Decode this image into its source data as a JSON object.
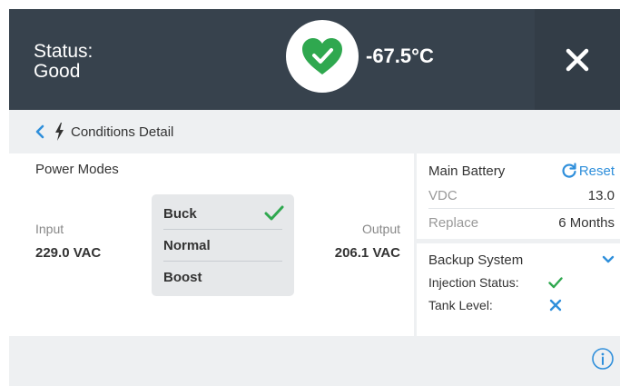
{
  "header": {
    "status_label": "Status:",
    "status_value": "Good",
    "temperature": "-67.5°C",
    "colors": {
      "background": "#37424d",
      "heart": "#2fa84f"
    }
  },
  "subbar": {
    "title": "Conditions Detail"
  },
  "power_modes": {
    "title": "Power Modes",
    "input_label": "Input",
    "input_value": "229.0 VAC",
    "output_label": "Output",
    "output_value": "206.1 VAC",
    "modes": [
      {
        "label": "Buck",
        "selected": true
      },
      {
        "label": "Normal",
        "selected": false
      },
      {
        "label": "Boost",
        "selected": false
      }
    ]
  },
  "main_battery": {
    "title": "Main Battery",
    "reset_label": "Reset",
    "vdc_label": "VDC",
    "vdc_value": "13.0",
    "replace_label": "Replace",
    "replace_value": "6 Months"
  },
  "backup_system": {
    "title": "Backup System",
    "injection_label": "Injection Status:",
    "injection_ok": true,
    "tank_label": "Tank Level:",
    "tank_ok": false
  },
  "icons": {
    "heart": "heart-check-icon",
    "close": "close-icon",
    "back": "chevron-left-icon",
    "bolt": "lightning-bolt-icon",
    "reset": "refresh-icon",
    "expand": "chevron-down-icon",
    "info": "info-icon",
    "accent_blue": "#2f8fdb",
    "accent_green": "#2fa84f"
  }
}
